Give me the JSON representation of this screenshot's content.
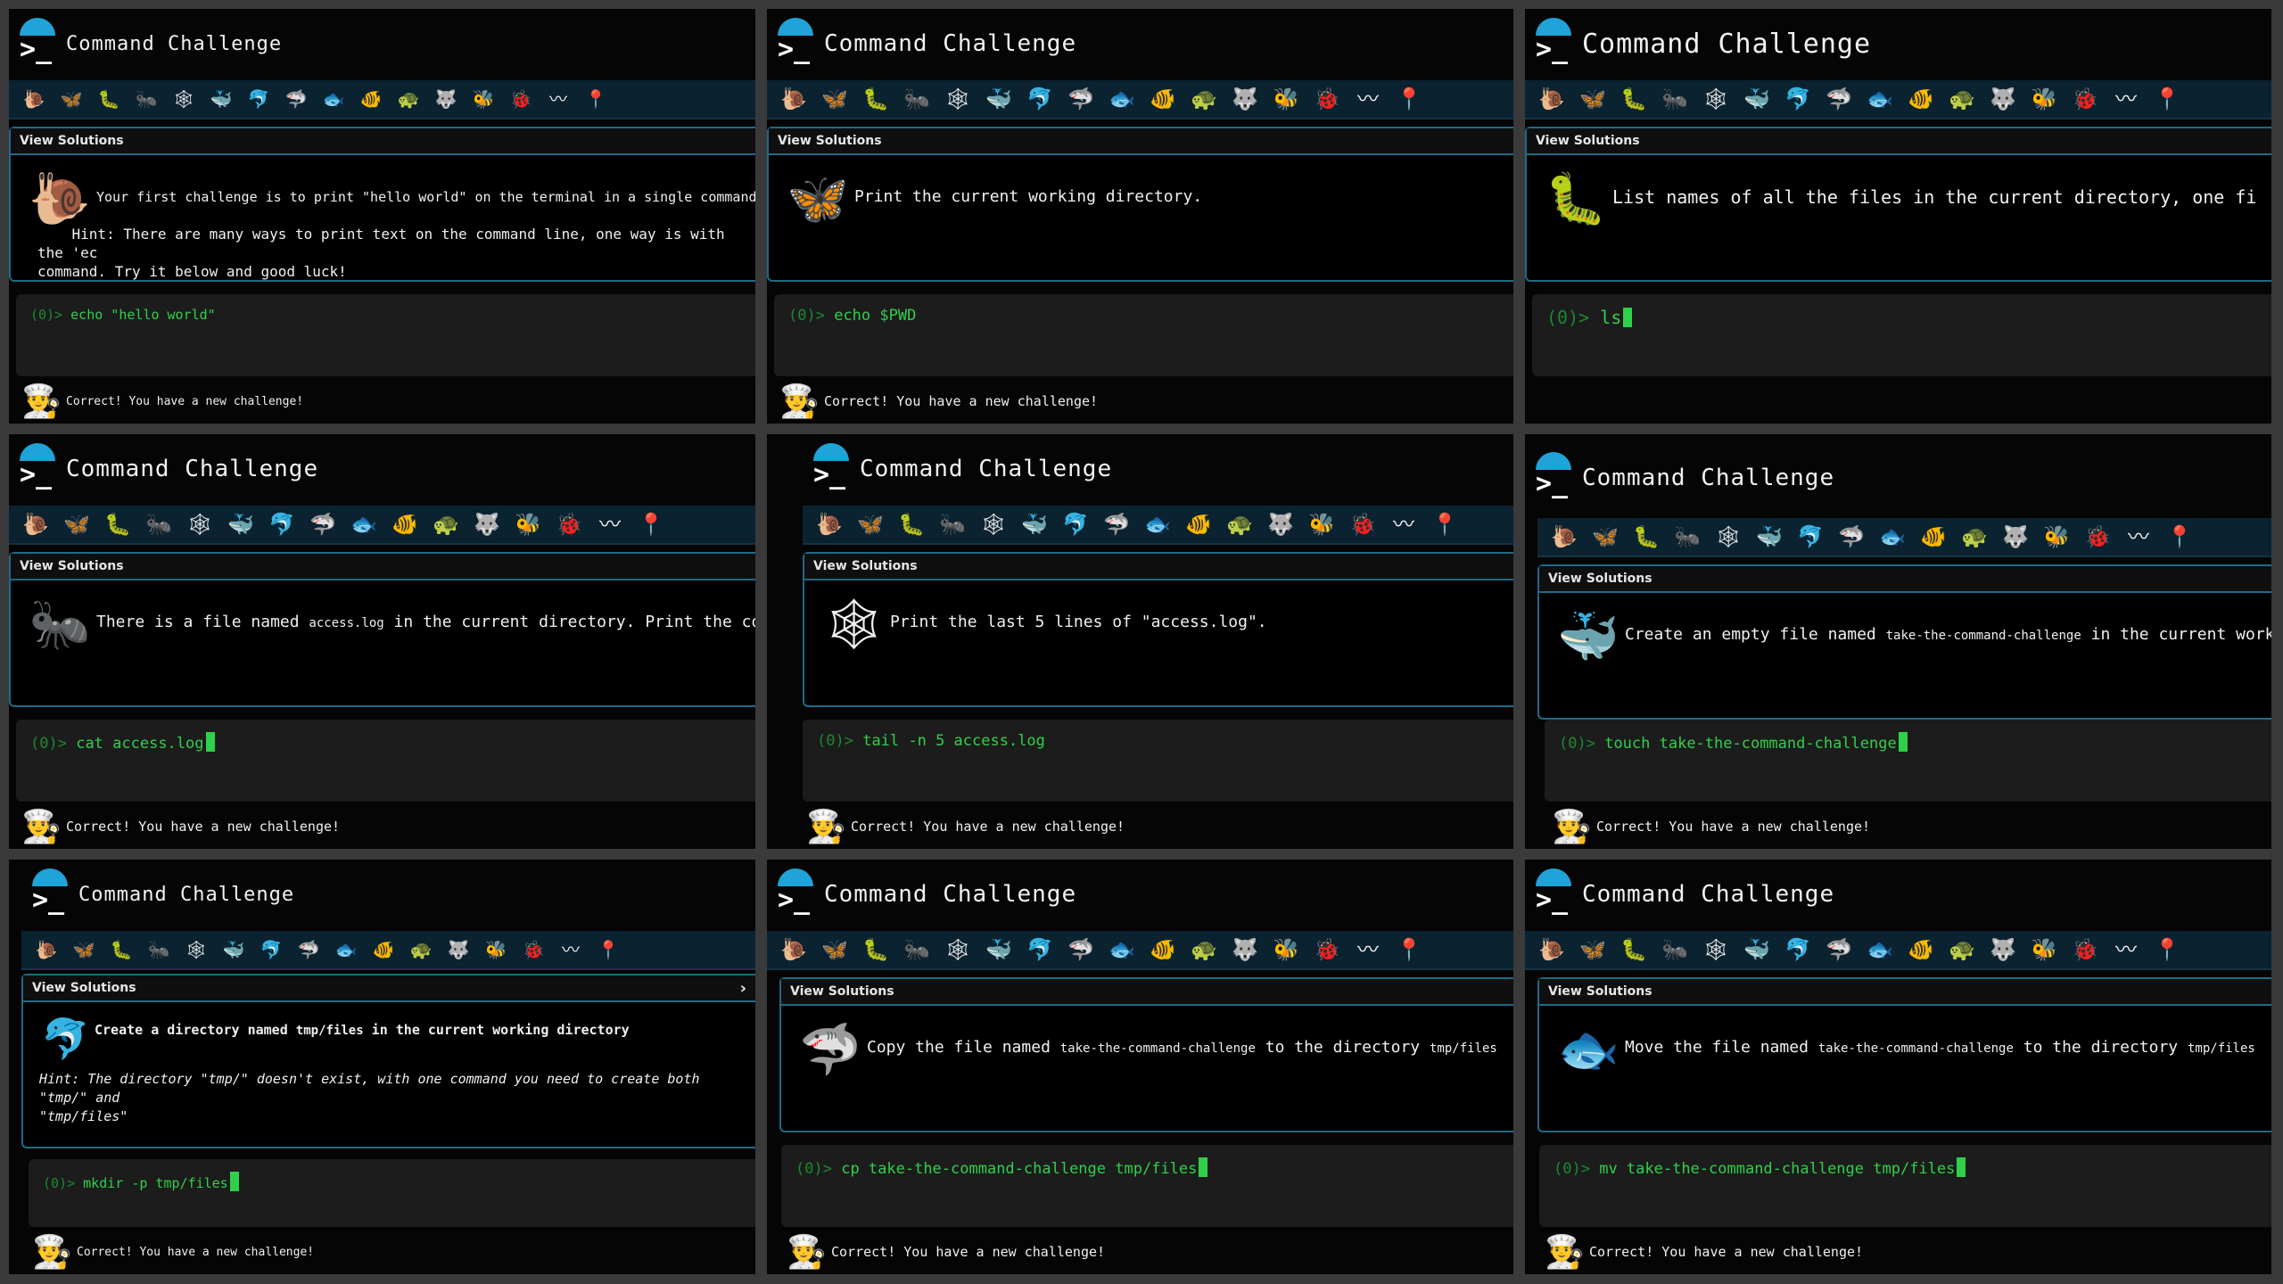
{
  "app_title": "Command Challenge",
  "logo_glyph": ">_",
  "badges": [
    {
      "name": "snail-badge",
      "glyph": "🐌"
    },
    {
      "name": "butterfly-badge",
      "glyph": "🦋"
    },
    {
      "name": "caterpillar-badge",
      "glyph": "🐛"
    },
    {
      "name": "ant-badge",
      "glyph": "🐜"
    },
    {
      "name": "spider-web-badge",
      "glyph": "🕸"
    },
    {
      "name": "whale-badge",
      "glyph": "🐳"
    },
    {
      "name": "dolphin-badge",
      "glyph": "🐬"
    },
    {
      "name": "shark-badge",
      "glyph": "🦈"
    },
    {
      "name": "fish-badge",
      "glyph": "🐟"
    },
    {
      "name": "tropical-fish-badge",
      "glyph": "🐠"
    },
    {
      "name": "turtle-badge",
      "glyph": "🐢"
    },
    {
      "name": "wolf-badge",
      "glyph": "🐺"
    },
    {
      "name": "bee-badge",
      "glyph": "🐝"
    },
    {
      "name": "ladybug-badge",
      "glyph": "🐞"
    },
    {
      "name": "worm-badge",
      "glyph": "〰"
    },
    {
      "name": "pin-badge",
      "glyph": "📍"
    }
  ],
  "view_solutions_label": "View Solutions",
  "feedback_text": "Correct! You have a new challenge!",
  "chef_glyph": "👨‍🍳",
  "prompt_prefix": "(0)>",
  "panels": [
    {
      "icon": "🐌",
      "icon_name": "snail-icon",
      "text_before": "Your first challenge is to print \"hello world\" on the terminal in a single command.",
      "code": "",
      "text_after": "",
      "hint": "    Hint: There are many ways to print text on the command line, one way is with the 'ec\ncommand. Try it below and good luck!",
      "command": "echo \"hello world\"",
      "cursor": false
    },
    {
      "icon": "🦋",
      "icon_name": "butterfly-icon",
      "text_before": "Print the current working directory.",
      "code": "",
      "text_after": "",
      "hint": "",
      "command": "echo $PWD",
      "cursor": false
    },
    {
      "icon": "🐛",
      "icon_name": "caterpillar-icon",
      "text_before": "List names of all the files in the current directory, one fi",
      "code": "",
      "text_after": "",
      "hint": "",
      "command": "ls",
      "cursor": true
    },
    {
      "icon": "🐜",
      "icon_name": "ant-icon",
      "text_before": "There is a file named ",
      "code": "access.log",
      "text_after": " in the current directory. Print the contents",
      "hint": "",
      "command": "cat access.log",
      "cursor": true
    },
    {
      "icon": "🕸",
      "icon_name": "spider-web-icon",
      "text_before": "Print the last 5 lines of \"access.log\".",
      "code": "",
      "text_after": "",
      "hint": "",
      "command": "tail -n 5 access.log",
      "cursor": false
    },
    {
      "icon": "🐳",
      "icon_name": "whale-icon",
      "text_before": "Create an empty file named ",
      "code": "take-the-command-challenge",
      "text_after": " in the current working di",
      "hint": "",
      "command": "touch take-the-command-challenge",
      "cursor": true
    },
    {
      "icon": "🐬",
      "icon_name": "dolphin-icon",
      "text_before": "Create a directory named ",
      "code": "tmp/files",
      "text_after": " in the current working directory",
      "hint": "Hint: The directory \"tmp/\" doesn't exist, with one command you need to create both \"tmp/\" and\n\"tmp/files\"",
      "command": "mkdir -p tmp/files",
      "cursor": true
    },
    {
      "icon": "🦈",
      "icon_name": "shark-icon",
      "text_before": "Copy the file named ",
      "code": "take-the-command-challenge",
      "text_after": " to the directory ",
      "code2": "tmp/files",
      "hint": "",
      "command": "cp take-the-command-challenge tmp/files",
      "cursor": true
    },
    {
      "icon": "🐟",
      "icon_name": "fish-icon",
      "text_before": "Move the file named ",
      "code": "take-the-command-challenge",
      "text_after": " to the directory ",
      "code2": "tmp/files",
      "hint": "",
      "command": "mv take-the-command-challenge tmp/files",
      "cursor": true
    }
  ]
}
